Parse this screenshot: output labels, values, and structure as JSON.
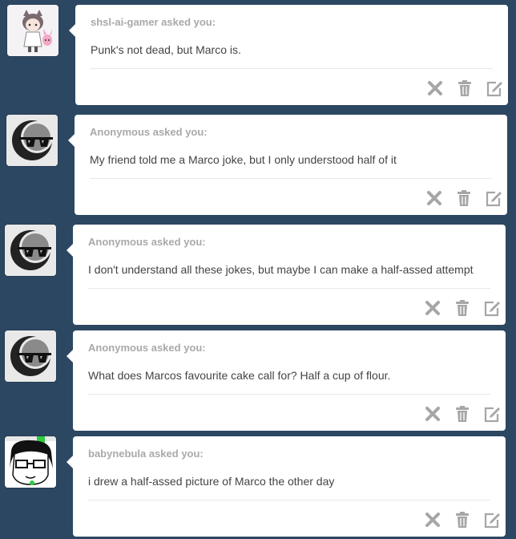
{
  "asks": [
    {
      "asker": "shsl-ai-gamer asked you:",
      "question": "Punk's not dead, but Marco is.",
      "avatar": "anime-character-avatar"
    },
    {
      "asker": "Anonymous asked you:",
      "question": "My friend told me a Marco joke, but I only understood half of it",
      "avatar": "anonymous-sunglasses-avatar"
    },
    {
      "asker": "Anonymous asked you:",
      "question": "I don't understand all these jokes, but maybe I can make a half-assed attempt",
      "avatar": "anonymous-sunglasses-avatar"
    },
    {
      "asker": "Anonymous asked you:",
      "question": "What does Marcos favourite cake call for? Half a cup of flour.",
      "avatar": "anonymous-sunglasses-avatar"
    },
    {
      "asker": "babynebula asked you:",
      "question": "i drew a half-assed picture of Marco the other day",
      "avatar": "comic-character-avatar"
    }
  ],
  "actions": {
    "delete_icon": "x-icon",
    "trash_icon": "trash-icon",
    "edit_icon": "edit-icon"
  },
  "colors": {
    "background": "#2c4762",
    "card": "#ffffff",
    "asker_text": "#a9a9a9",
    "question_text": "#444444",
    "icon": "#a6a6a6"
  }
}
